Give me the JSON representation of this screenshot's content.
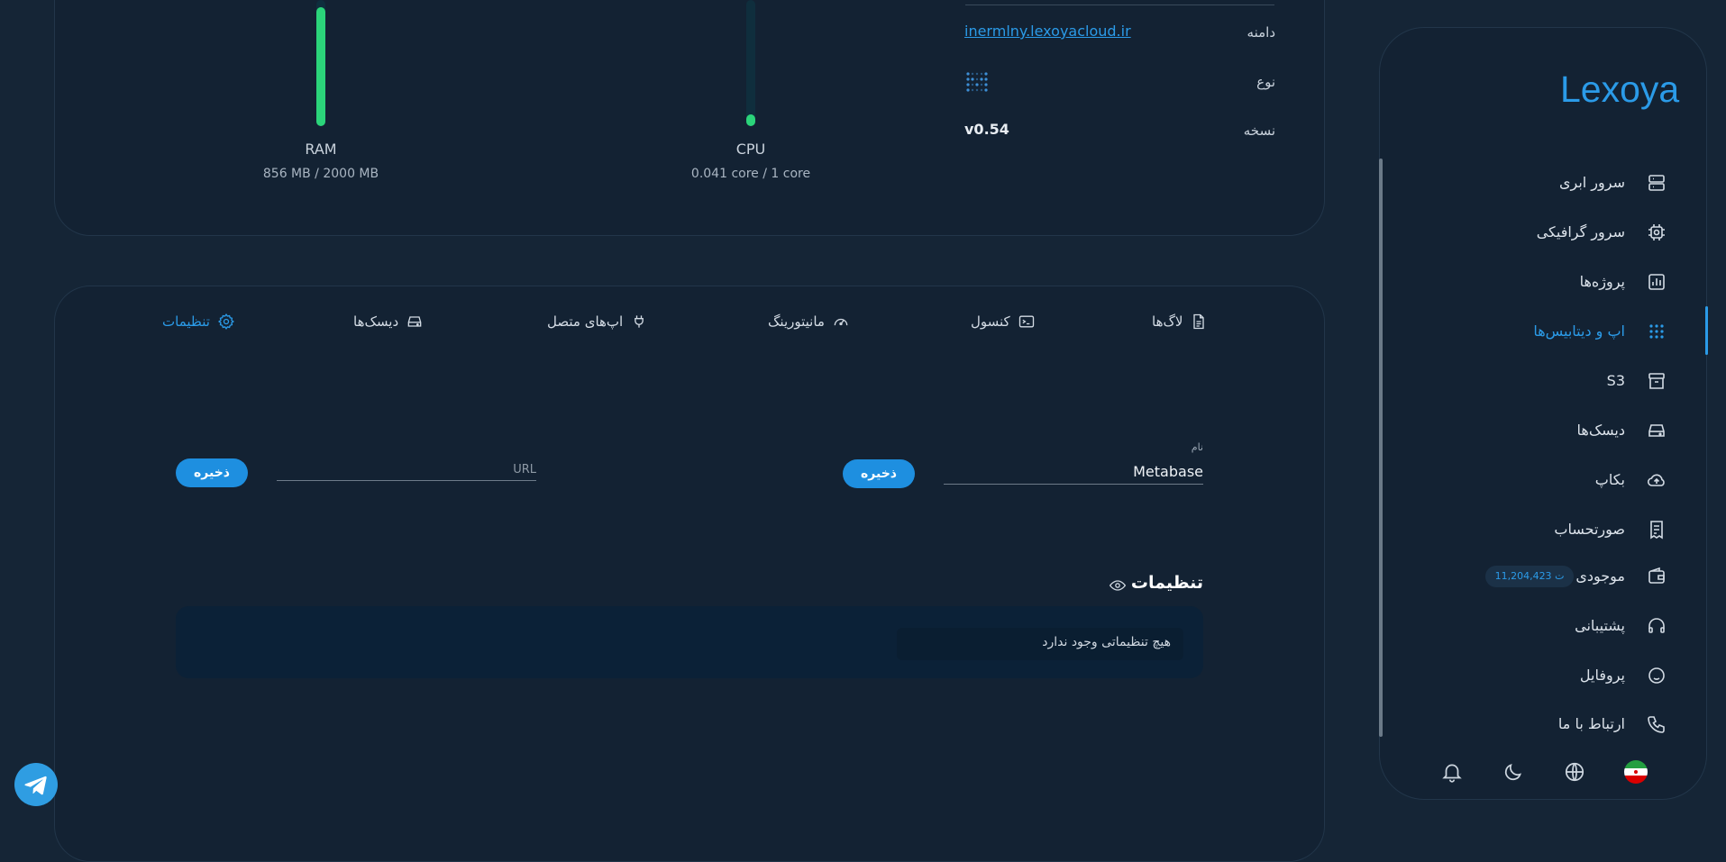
{
  "metrics": {
    "ram": {
      "label": "RAM",
      "value": "856 MB / 2000 MB",
      "fill_fraction": 0.428
    },
    "cpu": {
      "label": "CPU",
      "value": "0.041 core / 1 core",
      "fill_fraction": 0.041
    }
  },
  "info": {
    "domain": {
      "key": "دامنه",
      "value": "inermlny.lexoyacloud.ir"
    },
    "type": {
      "key": "نوع",
      "icon": "metabase-icon"
    },
    "version": {
      "key": "نسخه",
      "value": "v0.54"
    }
  },
  "tabs": [
    {
      "label": "لاگ‌ها",
      "icon": "log-file-icon"
    },
    {
      "label": "کنسول",
      "icon": "terminal-icon"
    },
    {
      "label": "مانیتورینگ",
      "icon": "gauge-icon"
    },
    {
      "label": "اپ‌های متصل",
      "icon": "plug-icon"
    },
    {
      "label": "دیسک‌ها",
      "icon": "disk-icon"
    },
    {
      "label": "تنظیمات",
      "icon": "gear-icon",
      "active": true
    }
  ],
  "form": {
    "name_label": "نام",
    "name_value": "Metabase",
    "url_placeholder": "URL",
    "save_label": "ذخیره"
  },
  "settings": {
    "title": "تنظیمات",
    "empty_text": "هیچ تنظیماتی وجود ندارد"
  },
  "sidebar": {
    "logo": "Lexoya",
    "items": [
      {
        "label": "سرور ابری",
        "icon": "server-icon"
      },
      {
        "label": "سرور گرافیکی",
        "icon": "chip-icon"
      },
      {
        "label": "پروژه‌ها",
        "icon": "chart-icon"
      },
      {
        "label": "اپ و دیتابیس‌ها",
        "icon": "grid-dots-icon",
        "active": true
      },
      {
        "label": "S3",
        "icon": "archive-icon"
      },
      {
        "label": "دیسک‌ها",
        "icon": "disk-icon"
      },
      {
        "label": "بکاپ",
        "icon": "cloud-upload-icon"
      },
      {
        "label": "صورتحساب",
        "icon": "receipt-icon"
      },
      {
        "label": "موجودی",
        "icon": "wallet-icon"
      },
      {
        "label": "پشتیبانی",
        "icon": "headset-icon"
      },
      {
        "label": "پروفایل",
        "icon": "face-icon"
      },
      {
        "label": "ارتباط با ما",
        "icon": "phone-icon"
      }
    ],
    "balance": "11,204,423 ت"
  },
  "colors": {
    "accent": "#2b9be8",
    "gauge": "#2bd47a",
    "background": "#152536"
  }
}
